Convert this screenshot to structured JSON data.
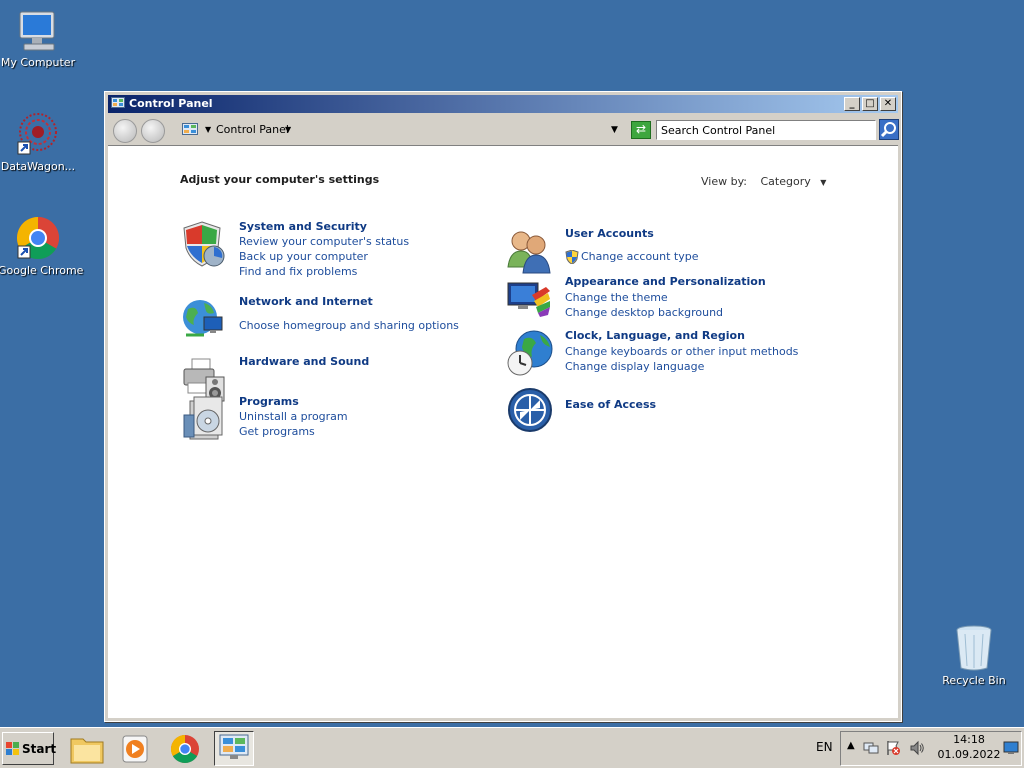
{
  "desktop": {
    "icons": {
      "my_computer": "My Computer",
      "datawagon": "DataWagon...",
      "chrome": "Google Chrome",
      "recycle_bin": "Recycle Bin"
    }
  },
  "window": {
    "title": "Control Panel",
    "controls": {
      "minimize": "_",
      "maximize": "□",
      "close": "✕"
    },
    "address": {
      "path": "Control Panel"
    },
    "search": {
      "placeholder": "Search Control Panel"
    }
  },
  "content": {
    "heading": "Adjust your computer's settings",
    "view_by": {
      "label": "View by:",
      "value": "Category"
    },
    "categories_left": [
      {
        "title": "System and Security",
        "links": [
          "Review your computer's status",
          "Back up your computer",
          "Find and fix problems"
        ]
      },
      {
        "title": "Network and Internet",
        "links": [
          "Choose homegroup and sharing options"
        ]
      },
      {
        "title": "Hardware and Sound",
        "links": []
      },
      {
        "title": "Programs",
        "links": [
          "Uninstall a program",
          "Get programs"
        ]
      }
    ],
    "categories_right": [
      {
        "title": "User Accounts",
        "links": [
          "Change account type"
        ]
      },
      {
        "title": "Appearance and Personalization",
        "links": [
          "Change the theme",
          "Change desktop background"
        ]
      },
      {
        "title": "Clock, Language, and Region",
        "links": [
          "Change keyboards or other input methods",
          "Change display language"
        ]
      },
      {
        "title": "Ease of Access",
        "links": []
      }
    ]
  },
  "taskbar": {
    "start_label": "Start",
    "language": "EN",
    "clock": {
      "time": "14:18",
      "date": "01.09.2022"
    }
  }
}
